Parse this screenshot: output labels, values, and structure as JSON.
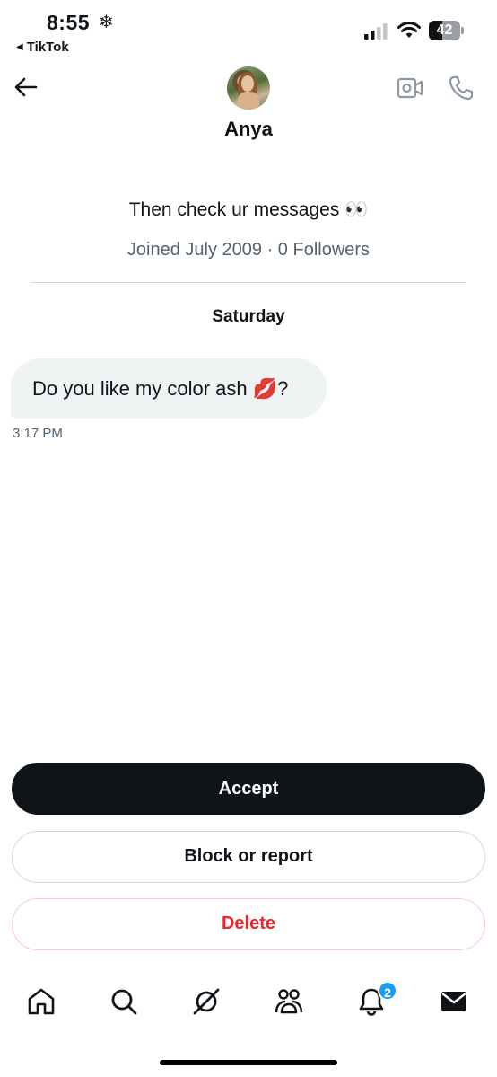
{
  "status_bar": {
    "time": "8:55",
    "time_icon": "snowflake-icon",
    "back_app_label": "TikTok",
    "battery_level": "42"
  },
  "header": {
    "profile_name": "Anya",
    "icons": [
      "back-arrow-icon",
      "video-call-icon",
      "phone-call-icon"
    ]
  },
  "profile": {
    "bio": "Then check ur messages 👀",
    "meta": "Joined July 2009 · 0 Followers"
  },
  "conversation": {
    "day_label": "Saturday",
    "messages": [
      {
        "text": "Do you like my color ash 💋?",
        "time": "3:17 PM"
      }
    ]
  },
  "actions": {
    "accept_label": "Accept",
    "block_label": "Block or report",
    "delete_label": "Delete"
  },
  "tab_bar": {
    "items": [
      "home-icon",
      "search-icon",
      "grok-icon",
      "communities-icon",
      "notifications-icon",
      "messages-icon"
    ],
    "notifications_badge": "2"
  },
  "colors": {
    "accept_bg": "#0f1419",
    "delete_text": "#f4212e",
    "badge": "#1d9bf0",
    "bubble_bg": "#eff3f4",
    "secondary_text": "#536471"
  }
}
